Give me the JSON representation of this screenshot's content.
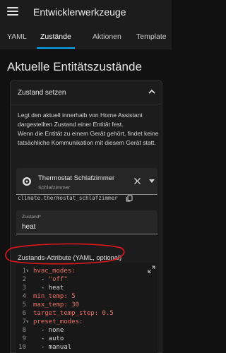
{
  "appbar": {
    "title": "Entwicklerwerkzeuge",
    "tabs": [
      {
        "label": "YAML"
      },
      {
        "label": "Zustände"
      },
      {
        "label": "Aktionen"
      },
      {
        "label": "Template"
      }
    ],
    "active_tab": "Zustände"
  },
  "page": {
    "title": "Aktuelle Entitätszustände"
  },
  "card": {
    "header": "Zustand setzen",
    "description_1": "Legt den aktuell innerhalb von Home Assistant dargestellten Zustand einer Entität fest.",
    "description_2": "Wenn die Entität zu einem Gerät gehört, findet keine tatsächliche Kommunikation mit diesem Gerät statt.",
    "entity": {
      "name": "Thermostat Schlafzimmer",
      "area": "Schlafzimmer",
      "entity_id": "climate.thermostat_schlafzimmer",
      "icon": "thermostat-icon"
    },
    "state_field": {
      "label": "Zustand*",
      "value": "heat"
    },
    "attributes_label": "Zustands-Attribute (YAML, optional)",
    "code_lines": [
      {
        "n": "1",
        "fold": true,
        "parts": [
          {
            "t": "hvac_modes:",
            "c": "k"
          }
        ]
      },
      {
        "n": "2",
        "fold": false,
        "parts": [
          {
            "t": "  - ",
            "c": "p"
          },
          {
            "t": "\"off\"",
            "c": "s"
          }
        ]
      },
      {
        "n": "3",
        "fold": false,
        "parts": [
          {
            "t": "  - heat",
            "c": "p"
          }
        ]
      },
      {
        "n": "4",
        "fold": false,
        "parts": [
          {
            "t": "min_temp: ",
            "c": "k"
          },
          {
            "t": "5",
            "c": "n"
          }
        ]
      },
      {
        "n": "5",
        "fold": false,
        "parts": [
          {
            "t": "max_temp: ",
            "c": "k"
          },
          {
            "t": "30",
            "c": "n"
          }
        ]
      },
      {
        "n": "6",
        "fold": false,
        "parts": [
          {
            "t": "target_temp_step: ",
            "c": "k"
          },
          {
            "t": "0.5",
            "c": "n"
          }
        ]
      },
      {
        "n": "7",
        "fold": true,
        "parts": [
          {
            "t": "preset_modes:",
            "c": "k"
          }
        ]
      },
      {
        "n": "8",
        "fold": false,
        "parts": [
          {
            "t": "  - none",
            "c": "p"
          }
        ]
      },
      {
        "n": "9",
        "fold": false,
        "parts": [
          {
            "t": "  - auto",
            "c": "p"
          }
        ]
      },
      {
        "n": "10",
        "fold": false,
        "parts": [
          {
            "t": "  - manual",
            "c": "p"
          }
        ]
      }
    ]
  },
  "colors": {
    "accent": "#03a9f4",
    "annotation": "#e0161b",
    "yaml_key": "#ec7063"
  }
}
